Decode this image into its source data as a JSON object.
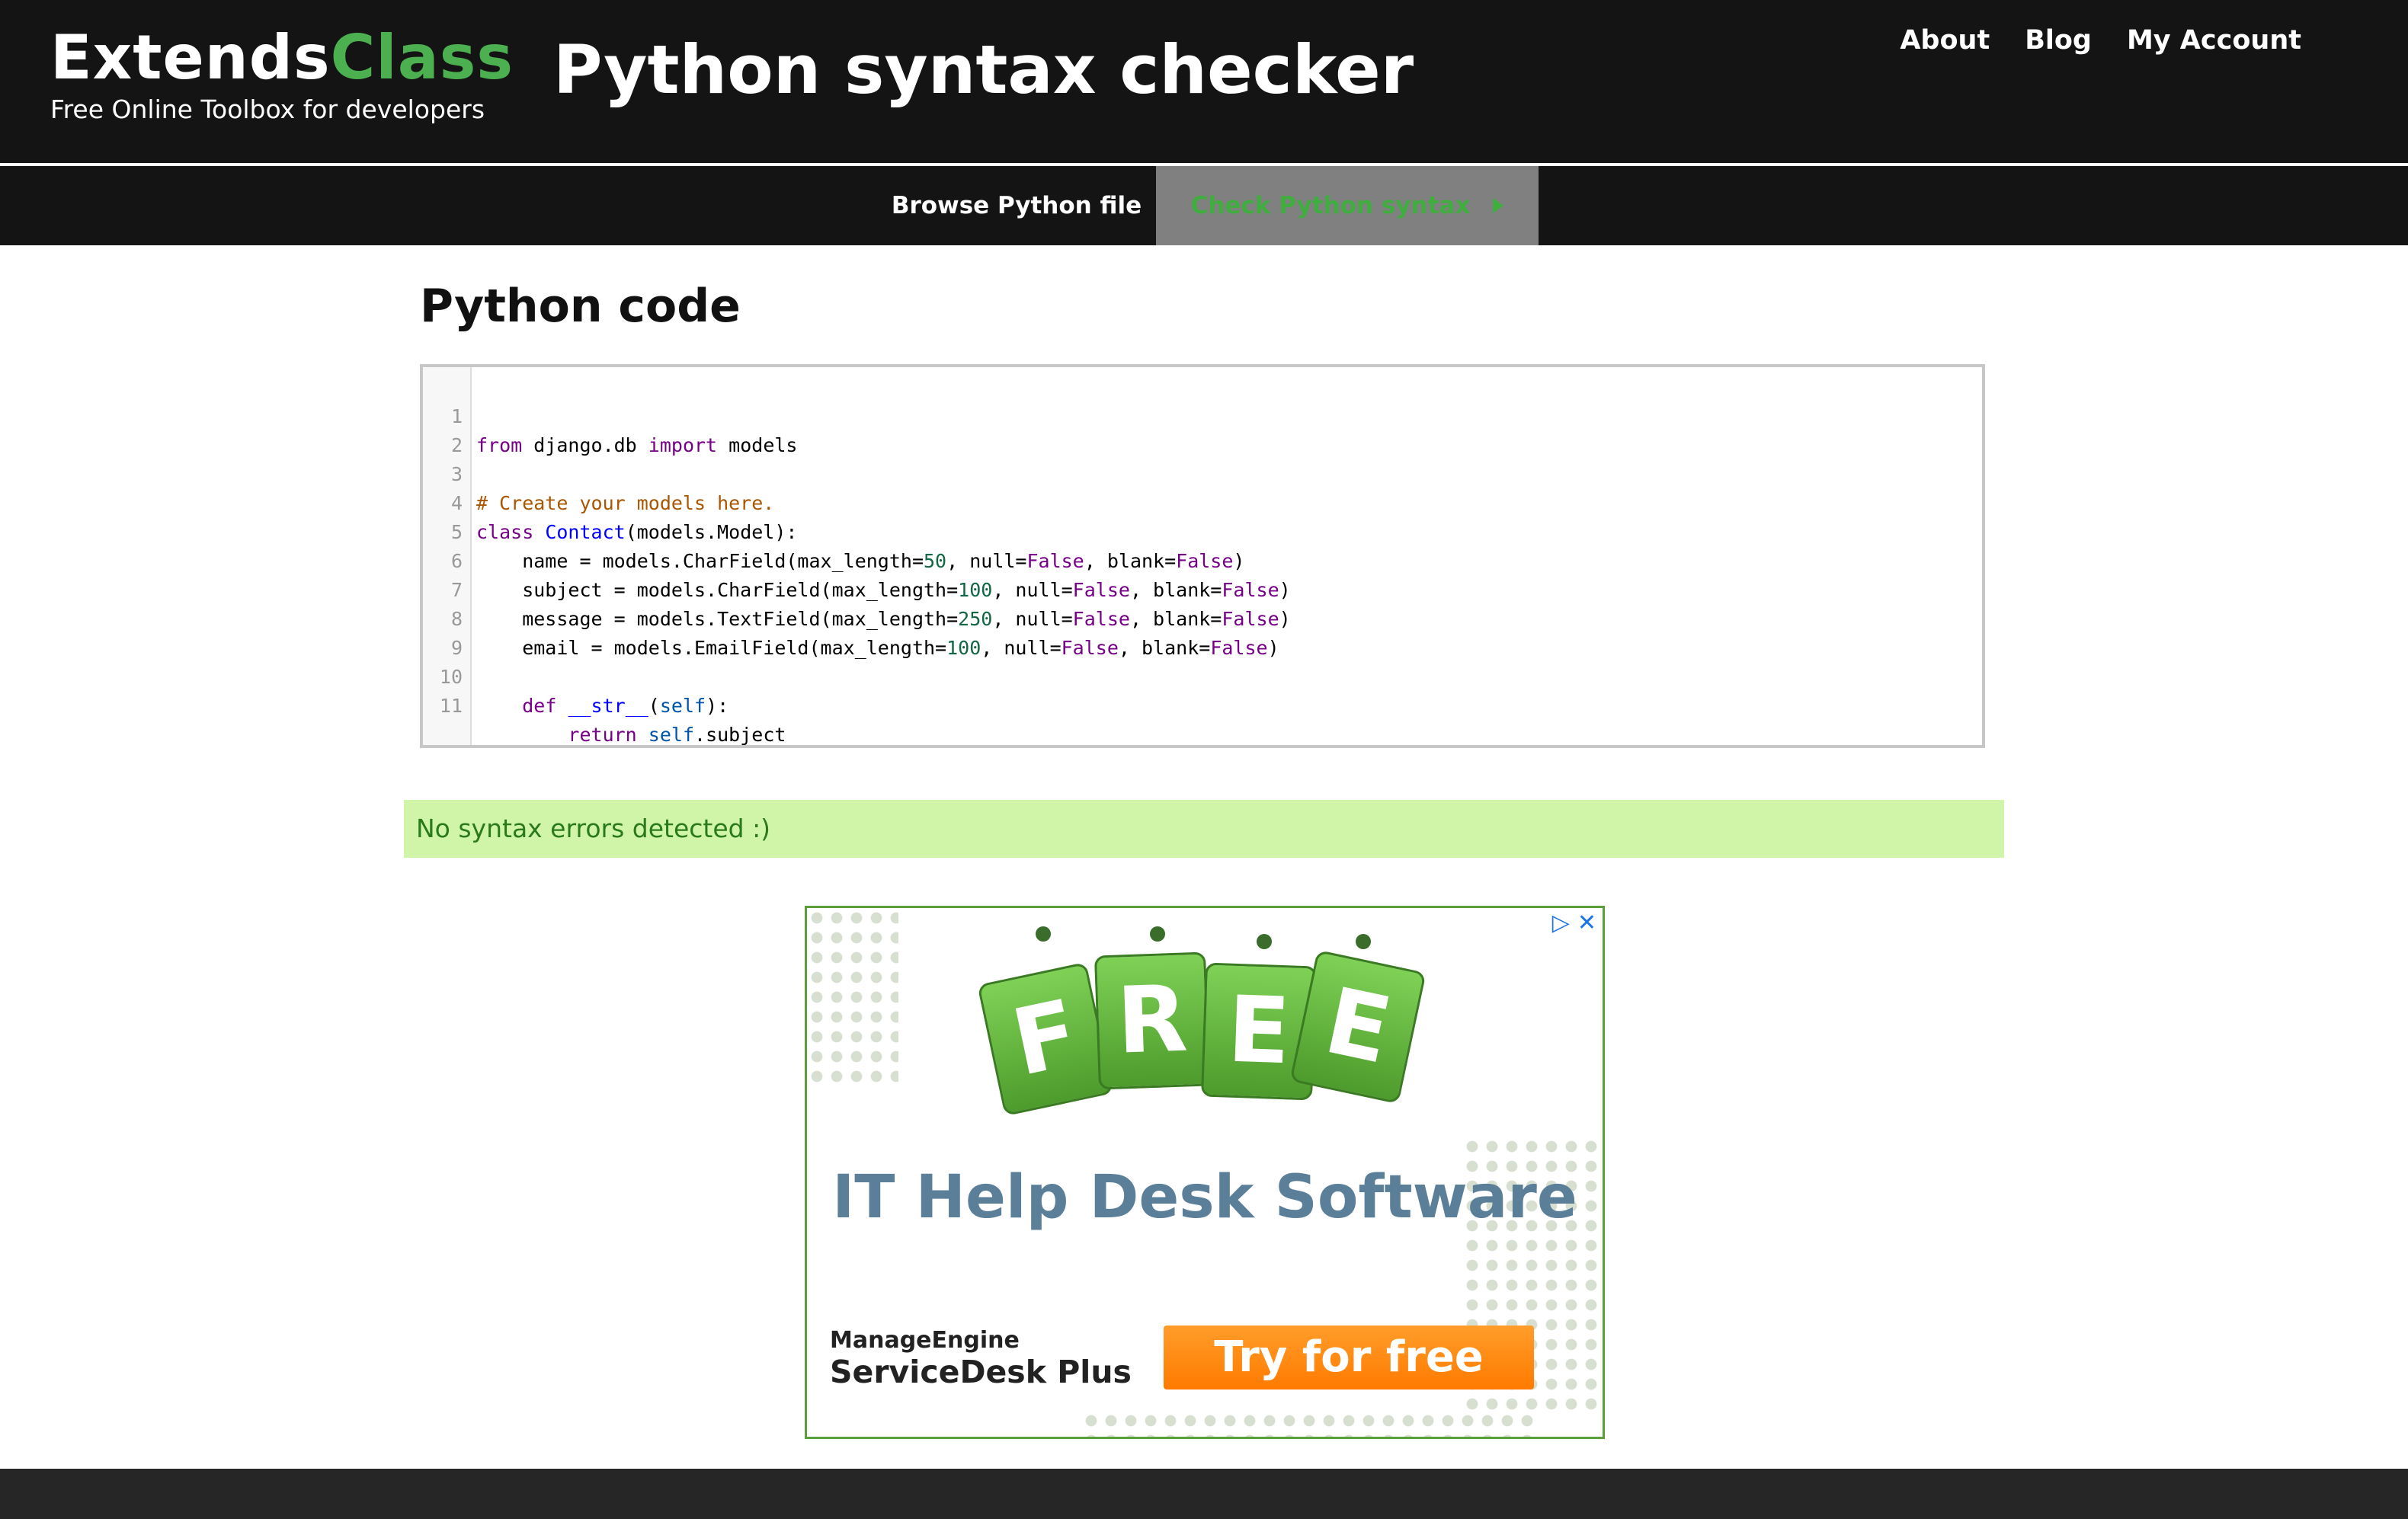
{
  "header": {
    "brand_main": "Extends",
    "brand_accent": "Class",
    "brand_tagline": "Free Online Toolbox for developers",
    "page_title": "Python syntax checker",
    "nav": [
      "About",
      "Blog",
      "My Account"
    ]
  },
  "tabs": {
    "browse_label": "Browse Python file",
    "check_label": "Check Python syntax"
  },
  "main": {
    "section_title": "Python code",
    "code_lines": [
      "from django.db import models",
      "",
      "# Create your models here.",
      "class Contact(models.Model):",
      "    name = models.CharField(max_length=50, null=False, blank=False)",
      "    subject = models.CharField(max_length=100, null=False, blank=False)",
      "    message = models.TextField(max_length=250, null=False, blank=False)",
      "    email = models.EmailField(max_length=100, null=False, blank=False)",
      "",
      "    def __str__(self):",
      "        return self.subject"
    ],
    "line_numbers": [
      "1",
      "2",
      "3",
      "4",
      "5",
      "6",
      "7",
      "8",
      "9",
      "10",
      "11"
    ],
    "status_message": "No syntax errors detected :)"
  },
  "ad": {
    "tag_letters": [
      "F",
      "R",
      "E",
      "E"
    ],
    "headline": "IT Help Desk Software",
    "brand_line1": "ManageEngine",
    "brand_line2": "ServiceDesk Plus",
    "cta": "Try for free",
    "adchoices_icon": "adchoices-icon",
    "close_icon": "close-icon"
  },
  "colors": {
    "header_bg": "#141414",
    "brand_accent": "#4caf50",
    "active_tab_bg": "#808080",
    "active_tab_text": "#3fae3f",
    "status_bg": "#d0f5a9",
    "status_text": "#2a7a1a",
    "cta_bg": "#ff7a00",
    "footer_bg": "#262626"
  }
}
